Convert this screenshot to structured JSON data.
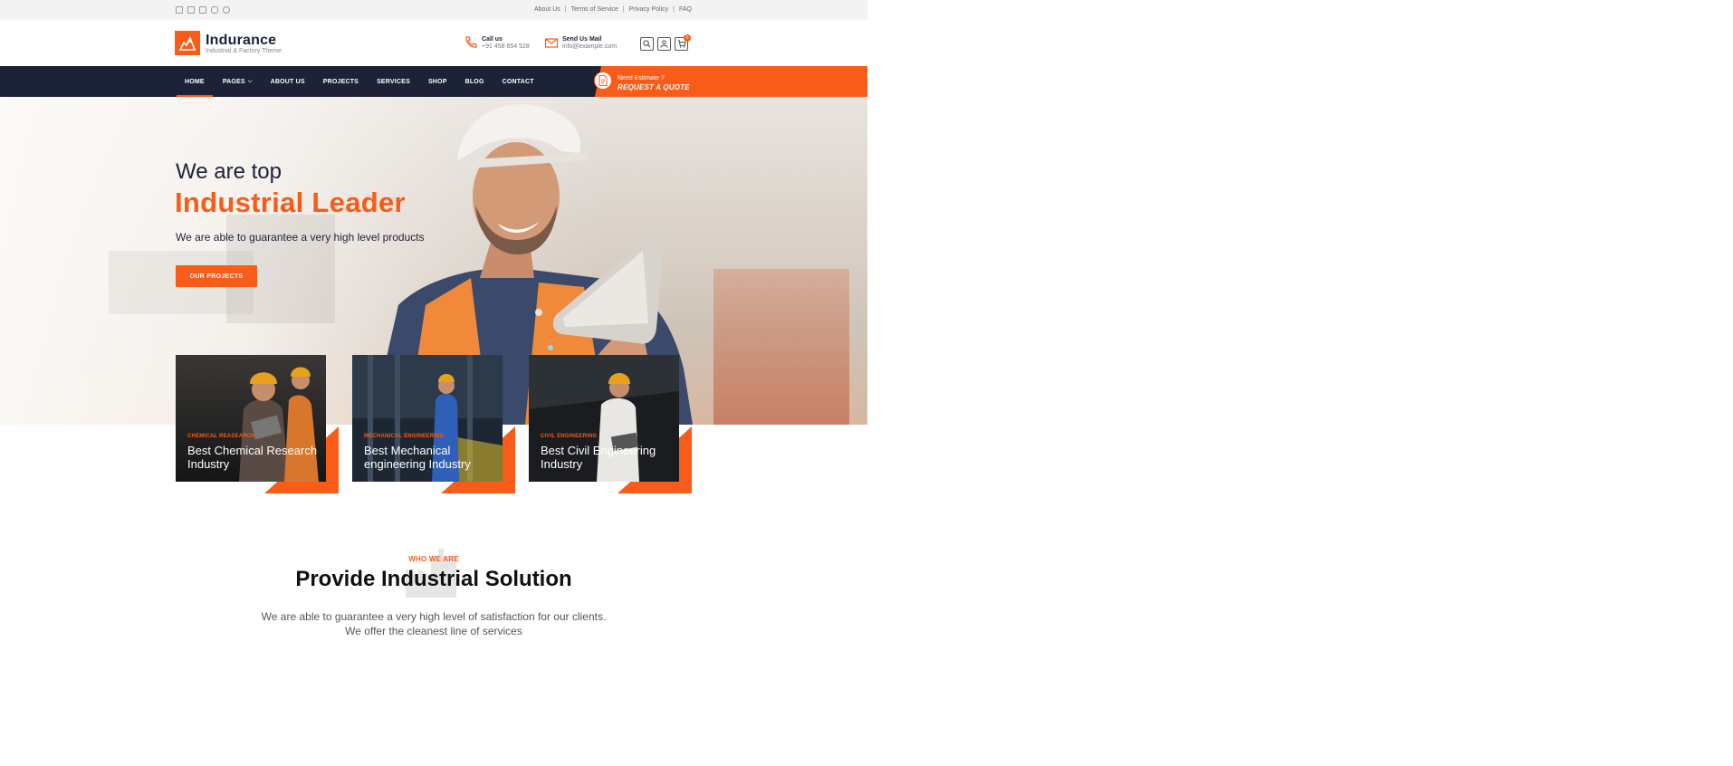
{
  "topbar": {
    "socials": [
      "facebook-icon",
      "twitter-icon",
      "linkedin-icon",
      "instagram-icon",
      "pinterest-icon"
    ],
    "links": [
      "About Us",
      "Terms of Service",
      "Privacy Policy",
      "FAQ"
    ]
  },
  "header": {
    "brand": "Indurance",
    "tagline": "Industrial & Factory Theme",
    "call_label": "Call us",
    "call_value": "+91 458 654 528",
    "mail_label": "Send Us Mail",
    "mail_value": "info@example.com",
    "cart_count": "0"
  },
  "nav": {
    "items": [
      "HOME",
      "PAGES",
      "ABOUT US",
      "PROJECTS",
      "SERVICES",
      "SHOP",
      "BLOG",
      "CONTACT"
    ],
    "active": "HOME",
    "quote_small": "Need Estimate ?",
    "quote_big": "REQUEST A QUOTE"
  },
  "hero": {
    "line1": "We are top",
    "line2": "Industrial Leader",
    "subtitle": "We are able to guarantee a very high level products",
    "button": "OUR PROJECTS"
  },
  "cards": [
    {
      "category": "CHEMICAL REASEARCH",
      "title": "Best Chemical Research Industry"
    },
    {
      "category": "MECHANICAL ENGINEERING",
      "title": "Best Mechanical engineering Industry"
    },
    {
      "category": "CIVIL ENGINEERING",
      "title": "Best Civil Engineering Industry"
    }
  ],
  "who": {
    "kicker": "WHO WE ARE",
    "title": "Provide Industrial Solution",
    "text_line1": "We are able to guarantee a very high level of satisfaction for our clients.",
    "text_line2": "We offer the cleanest line of services"
  },
  "colors": {
    "accent": "#f85c18",
    "navy": "#1c2237"
  }
}
